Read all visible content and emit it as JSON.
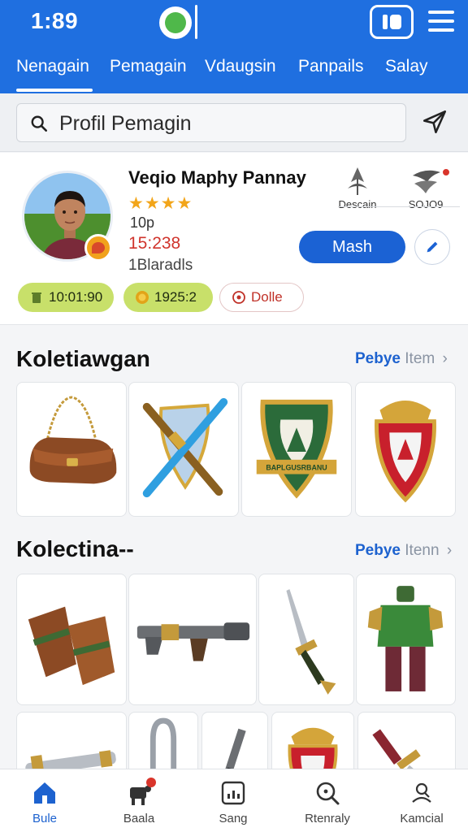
{
  "status_bar": {
    "time": "1:89"
  },
  "tabs": [
    {
      "label": "Nenagain"
    },
    {
      "label": "Pemagain"
    },
    {
      "label": "Vdaugsin"
    },
    {
      "label": "Panpails"
    },
    {
      "label": "Salay"
    }
  ],
  "search": {
    "value": "Profil Pemagin",
    "placeholder": "Profil Pemagin"
  },
  "profile": {
    "name": "Veqio Maphy Pannay",
    "stars": "★★★★",
    "rating_stars": 4,
    "level": "10p",
    "score": "15:238",
    "subtitle": "1Blaradls",
    "icon_tiles": [
      {
        "label": "Descain",
        "icon": "leaf-emblem-icon"
      },
      {
        "label": "SOJO9",
        "icon": "wing-emblem-icon"
      }
    ],
    "action_button": "Mash",
    "chips": [
      {
        "label": "10:01:90",
        "icon": "trash-icon"
      },
      {
        "label": "1925:2",
        "icon": "coin-icon"
      },
      {
        "label": "Dolle",
        "icon": "alert-circle-icon"
      }
    ]
  },
  "sections": [
    {
      "title": "Koletiawgan",
      "link_a": "Pebye",
      "link_b": "Item",
      "items": [
        {
          "icon": "leather-bag-icon"
        },
        {
          "icon": "crossed-weapons-shield-icon"
        },
        {
          "icon": "green-crest-shield-icon",
          "caption": "BAPLGUSRBANU"
        },
        {
          "icon": "crowned-red-shield-icon"
        }
      ]
    },
    {
      "title": "Kolectina-‐",
      "link_a": "Pebye",
      "link_b": "Itenn",
      "items": [
        {
          "icon": "leather-gauntlets-icon"
        },
        {
          "icon": "rifle-icon"
        },
        {
          "icon": "dagger-icon"
        },
        {
          "icon": "green-armor-icon"
        },
        {
          "icon": "scroll-tube-icon"
        },
        {
          "icon": "metal-loop-icon"
        },
        {
          "icon": "spike-tool-icon"
        },
        {
          "icon": "crowned-shield-icon"
        },
        {
          "icon": "red-sword-icon"
        }
      ]
    }
  ],
  "bottom_nav": [
    {
      "label": "Bule",
      "icon": "home-icon"
    },
    {
      "label": "Baala",
      "icon": "cart-pet-icon"
    },
    {
      "label": "Sang",
      "icon": "stats-icon"
    },
    {
      "label": "Rtenraly",
      "icon": "search-icon"
    },
    {
      "label": "Kamcial",
      "icon": "profile-icon"
    }
  ],
  "colors": {
    "primary": "#1f6fe0",
    "accent_blue": "#1b62d4",
    "star": "#f2a51a",
    "score_red": "#d0342c",
    "chip_green": "#c8e06a"
  }
}
